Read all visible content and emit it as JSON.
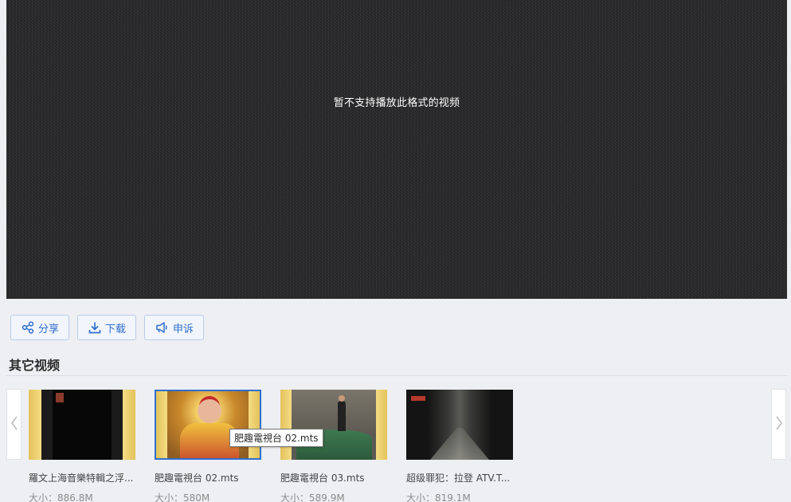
{
  "player": {
    "message": "暂不支持播放此格式的视频"
  },
  "actions": {
    "share_label": "分享",
    "download_label": "下载",
    "report_label": "申诉"
  },
  "section": {
    "title": "其它视频"
  },
  "videos": [
    {
      "title": "羅文上海音樂特輯之浮...",
      "size": "大小：886.8M"
    },
    {
      "title": "肥趣電視台 02.mts",
      "size": "大小：580M"
    },
    {
      "title": "肥趣電視台 03.mts",
      "size": "大小：589.9M"
    },
    {
      "title": "超级罪犯：拉登 ATV.T...",
      "size": "大小：819.1M"
    }
  ],
  "tooltip": {
    "text": "肥趣電視台 02.mts"
  },
  "colors": {
    "accent": "#2f6fcf",
    "background": "#eeeff3",
    "player_bg": "#2a2a2c"
  },
  "icons": {
    "share": "share-icon",
    "download": "download-icon",
    "report": "megaphone-icon",
    "prev": "chevron-left-icon",
    "next": "chevron-right-icon"
  }
}
